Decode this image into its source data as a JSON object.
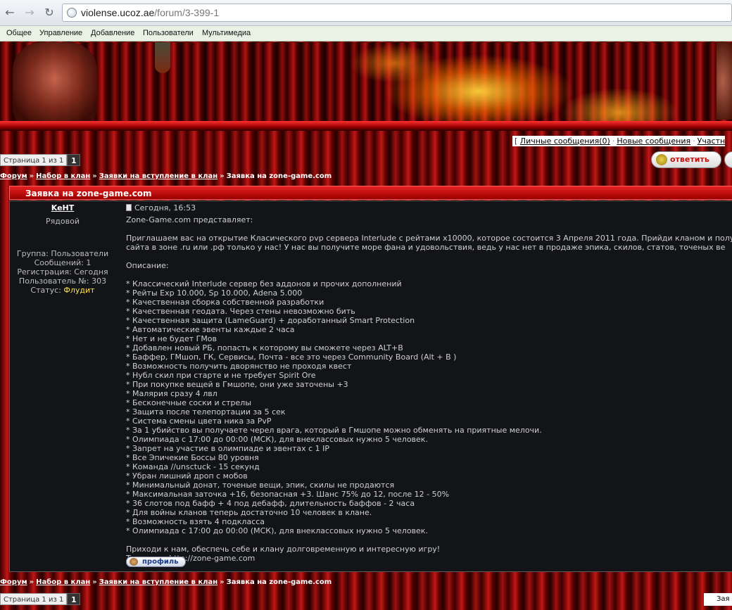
{
  "browser": {
    "url_host": "violense.ucoz.ae",
    "url_path": "/forum/3-399-1",
    "bookmarks": [
      "Общее",
      "Управление",
      "Добавление",
      "Пользователи",
      "Мультимедиа"
    ]
  },
  "toplinks": {
    "bracket": "[",
    "messages": "Личные сообщения(0)",
    "new_messages": "Новые сообщения",
    "members": "Участн",
    "sep": "·"
  },
  "pager": {
    "label": "Страница 1 из 1",
    "current": "1"
  },
  "reply_button": "ответить",
  "breadcrumb": {
    "forum": "Форум",
    "section": "Набор в клан",
    "subsection": "Заявки на вступление в клан",
    "current": "Заявка на zone-game.com",
    "arrow": "»"
  },
  "post": {
    "title": "Заявка на zone-game.com",
    "author": {
      "name": "KeHT",
      "rank": "Рядовой",
      "group": "Группа: Пользователи",
      "messages": "Сообщений: 1",
      "registered": "Регистрация: Сегодня",
      "user_no": "Пользователь №: 303",
      "status_label": "Статус:",
      "status_value": "Флудит"
    },
    "date": "Сегодня, 16:53",
    "intro": "Zone-Game.com представляет:",
    "invite_line1": "Приглашаем вас на открытие Класического pvp сервера Interlude с рейтами x10000, которое состоится 3 Апреля 2011 года. Прийди кланом и получи",
    "invite_line2": "сайта в зоне .ru или .рф только у нас! У нас вы получите море фана и удовольствия, ведь у нас нет в продаже эпика, скилов, статов, точеных ве",
    "desc_label": "Описание:",
    "features": [
      "* Классический Interlude сервер без аддонов и прочих дополнений",
      "* Рейты Exp 10.000, Sp 10.000, Adena 5.000",
      "* Качественная сборка собственной разработки",
      "* Качественная геодата. Через стены невозможно бить",
      "* Качественная защита (LameGuard) + доработанный Smart Protection",
      "* Автоматические эвенты каждые 2 часа",
      "* Нет и не будет ГМов",
      "* Добавлен новый РБ, попасть к которому вы сможете через ALT+B",
      "* Баффер, ГМшоп, ГК, Сервисы, Почта - все это через Community Board (Alt + B )",
      "* Возможность получить дворянство не проходя квест",
      "* Нубл скил при старте и не требует Spirit Ore",
      "* При покупке вещей в Гмшопе, они уже заточены +3",
      "* Малярия сразу 4 лвл",
      "* Бесконечные соски и стрелы",
      "* Защита после телепортации за 5 сек",
      "* Система смены цвета ника за PvP",
      "* За 1 убийство вы получаете черел врага, который в Гмшопе можно обменять на приятные мелочи.",
      "* Олимпиада с 17:00 до 00:00 (МСК), для внеклассовых нужно 5 человек.",
      "* Запрет на участие в олимпиаде и эвентах с 1 IP",
      "* Все Эпичекие Боссы 80 уровня",
      "* Команда //unsctuck - 15 секунд",
      "* Убран лишний дроп с мобов",
      "* Минимальный донат, точеные вещи, эпик, скилы не продаются",
      "* Максимальная заточка +16, безопасная +3. Шанс 75% до 12, после 12 - 50%",
      "* 36 слотов под бафф + 4 под дебафф, длительность баффов - 2 часа",
      "* Для войны кланов теперь достаточно 10 человек в клане.",
      "* Возможность взять 4 подкласса",
      "* Олимпиада с 17:00 до 00:00 (МСК), для внеклассовых нужно 5 человек."
    ],
    "outro1": "Приходи к нам, обеспечь себе и клану долговременную и интересную игру!",
    "outro2": "Только на http://zone-game.com",
    "profile_button": "профиль"
  },
  "bottom_right_button": "Зая"
}
